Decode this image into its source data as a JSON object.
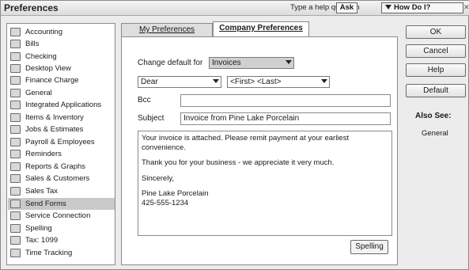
{
  "window": {
    "title": "Preferences"
  },
  "help": {
    "question_placeholder": "Type a help question",
    "ask_label": "Ask",
    "how_do_i_label": "How Do I?"
  },
  "sidebar": {
    "items": [
      {
        "label": "Accounting",
        "icon": "accounting-icon",
        "selected": false
      },
      {
        "label": "Bills",
        "icon": "bills-icon",
        "selected": false
      },
      {
        "label": "Checking",
        "icon": "checking-icon",
        "selected": false
      },
      {
        "label": "Desktop View",
        "icon": "desktop-view-icon",
        "selected": false
      },
      {
        "label": "Finance Charge",
        "icon": "finance-charge-icon",
        "selected": false
      },
      {
        "label": "General",
        "icon": "general-icon",
        "selected": false
      },
      {
        "label": "Integrated Applications",
        "icon": "integrated-applications-icon",
        "selected": false
      },
      {
        "label": "Items & Inventory",
        "icon": "items-inventory-icon",
        "selected": false
      },
      {
        "label": "Jobs & Estimates",
        "icon": "jobs-estimates-icon",
        "selected": false
      },
      {
        "label": "Payroll & Employees",
        "icon": "payroll-employees-icon",
        "selected": false
      },
      {
        "label": "Reminders",
        "icon": "reminders-icon",
        "selected": false
      },
      {
        "label": "Reports & Graphs",
        "icon": "reports-graphs-icon",
        "selected": false
      },
      {
        "label": "Sales & Customers",
        "icon": "sales-customers-icon",
        "selected": false
      },
      {
        "label": "Sales Tax",
        "icon": "sales-tax-icon",
        "selected": false
      },
      {
        "label": "Send Forms",
        "icon": "send-forms-icon",
        "selected": true
      },
      {
        "label": "Service Connection",
        "icon": "service-connection-icon",
        "selected": false
      },
      {
        "label": "Spelling",
        "icon": "spelling-icon",
        "selected": false
      },
      {
        "label": "Tax: 1099",
        "icon": "tax-1099-icon",
        "selected": false
      },
      {
        "label": "Time Tracking",
        "icon": "time-tracking-icon",
        "selected": false
      }
    ]
  },
  "tabs": [
    {
      "label": "My Preferences",
      "active": false
    },
    {
      "label": "Company Preferences",
      "active": true
    }
  ],
  "form": {
    "change_default_label": "Change default for",
    "change_default_value": "Invoices",
    "greeting_value": "Dear",
    "name_format_value": "<First> <Last>",
    "bcc_label": "Bcc",
    "bcc_value": "",
    "subject_label": "Subject",
    "subject_value": "Invoice from Pine Lake Porcelain",
    "message": {
      "line1": "Your invoice is attached.  Please remit payment at your earliest convenience.",
      "line2": "Thank you for your business - we appreciate it very much.",
      "line3": "Sincerely,",
      "line4": "Pine Lake Porcelain",
      "line5": "425-555-1234"
    },
    "spelling_button": "Spelling"
  },
  "buttons": {
    "ok": "OK",
    "cancel": "Cancel",
    "help": "Help",
    "default": "Default"
  },
  "also_see": {
    "title": "Also See:",
    "links": [
      "General"
    ]
  },
  "colors": {
    "selected_row": "#c9c9c9",
    "window_bg": "#ececec"
  }
}
